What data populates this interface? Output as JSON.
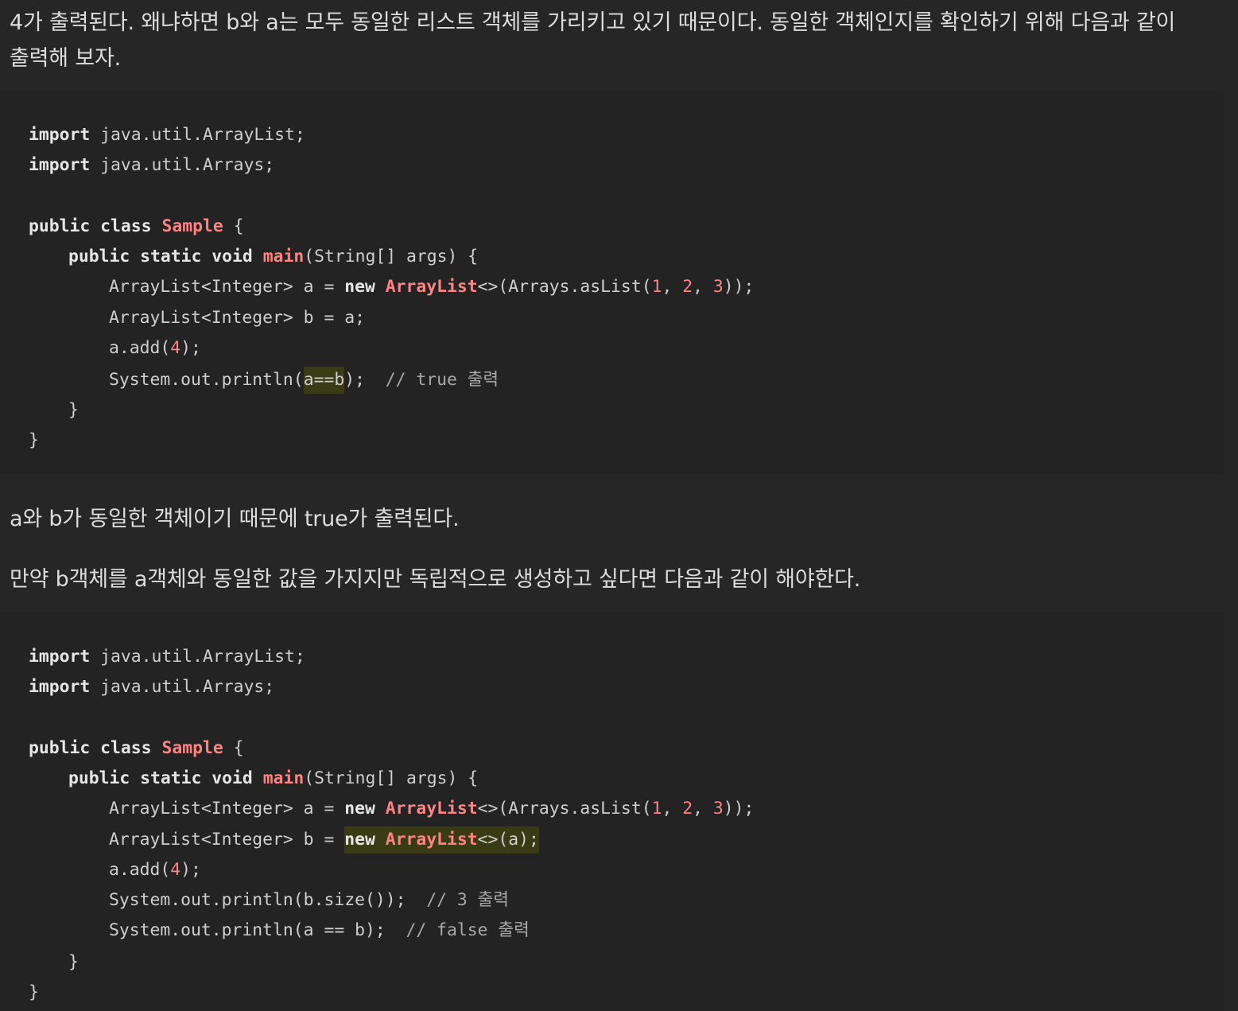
{
  "intro_text": "4가 출력된다. 왜냐하면 b와 a는 모두 동일한 리스트 객체를 가리키고 있기 때문이다. 동일한 객체인지를 확인하기 위해 다음과 같이 출력해 보자.",
  "same_object_text": "a와 b가 동일한 객체이기 때문에 true가 출력된다.",
  "copy_text": "만약 b객체를 a객체와 동일한 값을 가지지만 독립적으로 생성하고 싶다면 다음과 같이 해야한다.",
  "code1": {
    "l1_kw": "import",
    "l1_rest": " java.util.ArrayList;",
    "l2_kw": "import",
    "l2_rest": " java.util.Arrays;",
    "l3_kw": "public class",
    "l3_cls": "Sample",
    "l3_rest": " {",
    "l4_kw": "public static void",
    "l4_fn": "main",
    "l4_rest": "(String[] args) {",
    "l5_a": "ArrayList<Integer> a = ",
    "l5_kw": "new",
    "l5_cls": "ArrayList",
    "l5_b": "<>(Arrays.asList(",
    "l5_n1": "1",
    "l5_c1": ", ",
    "l5_n2": "2",
    "l5_c2": ", ",
    "l5_n3": "3",
    "l5_end": "));",
    "l6": "ArrayList<Integer> b = a;",
    "l7_a": "a.add(",
    "l7_n": "4",
    "l7_end": ");",
    "l8_a": "System.out.println(",
    "l8_hl": "a==b",
    "l8_end": ");  ",
    "l8_cm": "// true 출력",
    "l9": "}",
    "l10": "}"
  },
  "code2": {
    "l1_kw": "import",
    "l1_rest": " java.util.ArrayList;",
    "l2_kw": "import",
    "l2_rest": " java.util.Arrays;",
    "l3_kw": "public class",
    "l3_cls": "Sample",
    "l3_rest": " {",
    "l4_kw": "public static void",
    "l4_fn": "main",
    "l4_rest": "(String[] args) {",
    "l5_a": "ArrayList<Integer> a = ",
    "l5_kw": "new",
    "l5_cls": "ArrayList",
    "l5_b": "<>(Arrays.asList(",
    "l5_n1": "1",
    "l5_c1": ", ",
    "l5_n2": "2",
    "l5_c2": ", ",
    "l5_n3": "3",
    "l5_end": "));",
    "l6_a": "ArrayList<Integer> b = ",
    "l6_kw": "new",
    "l6_cls": "ArrayList",
    "l6_end": "<>(a);",
    "l7_a": "a.add(",
    "l7_n": "4",
    "l7_end": ");",
    "l8_a": "System.out.println(b.size());  ",
    "l8_cm": "// 3 출력",
    "l9_a": "System.out.println(a == b);  ",
    "l9_cm": "// false 출력",
    "l10": "}",
    "l11": "}"
  }
}
